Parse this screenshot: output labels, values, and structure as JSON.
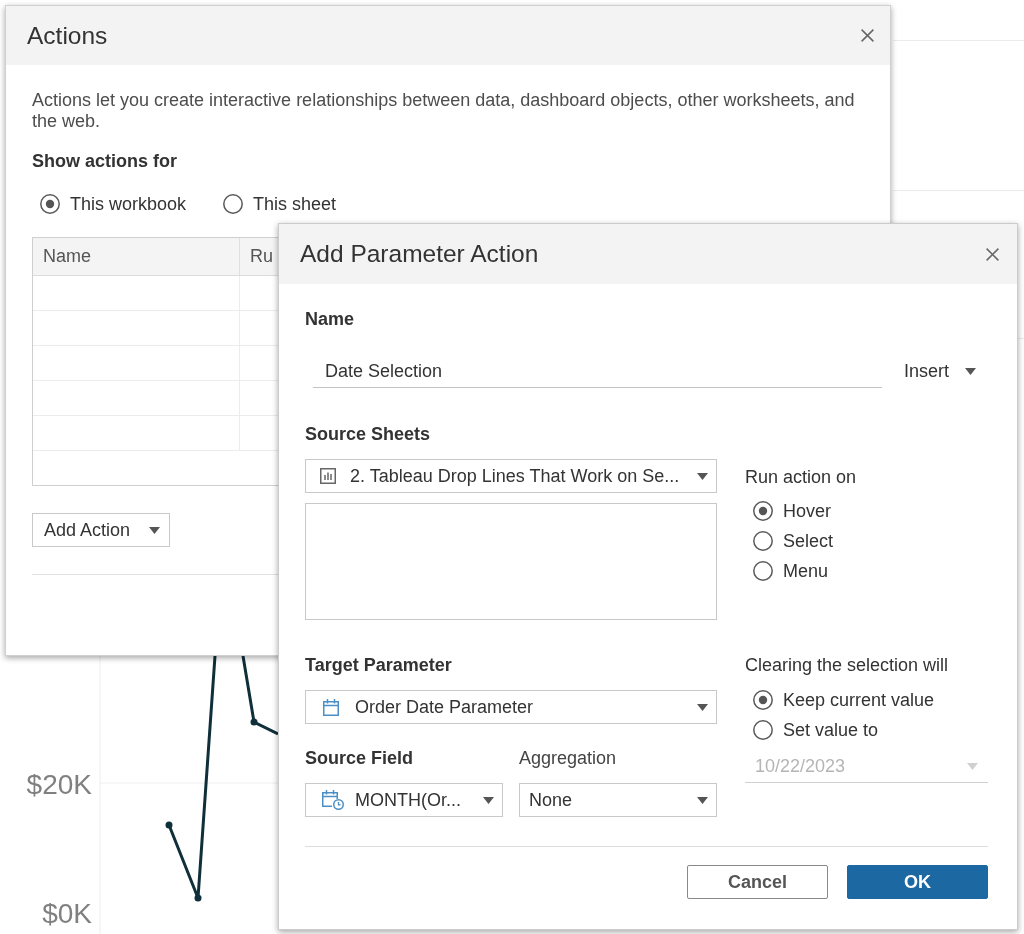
{
  "background_chart": {
    "y_axis_labels": [
      "$20K",
      "$0K"
    ]
  },
  "actions_dialog": {
    "title": "Actions",
    "description": "Actions let you create interactive relationships between data, dashboard objects, other worksheets, and the web.",
    "show_actions_for": {
      "label": "Show actions for",
      "options": [
        {
          "label": "This workbook",
          "selected": true
        },
        {
          "label": "This sheet",
          "selected": false
        }
      ]
    },
    "table": {
      "columns": [
        "Name",
        "Ru"
      ]
    },
    "add_button": "Add Action"
  },
  "parameter_dialog": {
    "title": "Add Parameter Action",
    "name": {
      "label": "Name",
      "value": "Date Selection",
      "insert_button": "Insert"
    },
    "source_sheets": {
      "label": "Source Sheets",
      "value": "2. Tableau Drop Lines That Work on Se..."
    },
    "run_action_on": {
      "label": "Run action on",
      "options": [
        {
          "label": "Hover",
          "selected": true
        },
        {
          "label": "Select",
          "selected": false
        },
        {
          "label": "Menu",
          "selected": false
        }
      ]
    },
    "target_parameter": {
      "label": "Target Parameter",
      "value": "Order Date Parameter"
    },
    "clearing": {
      "label": "Clearing the selection will",
      "options": [
        {
          "label": "Keep current value",
          "selected": true
        },
        {
          "label": "Set value to",
          "selected": false
        }
      ],
      "value_field": {
        "value": "10/22/2023",
        "disabled": true
      }
    },
    "source_field": {
      "label": "Source Field",
      "value": "MONTH(Or..."
    },
    "aggregation": {
      "label": "Aggregation",
      "value": "None"
    },
    "buttons": [
      {
        "label": "Cancel",
        "kind": "secondary"
      },
      {
        "label": "OK",
        "kind": "primary"
      }
    ]
  }
}
